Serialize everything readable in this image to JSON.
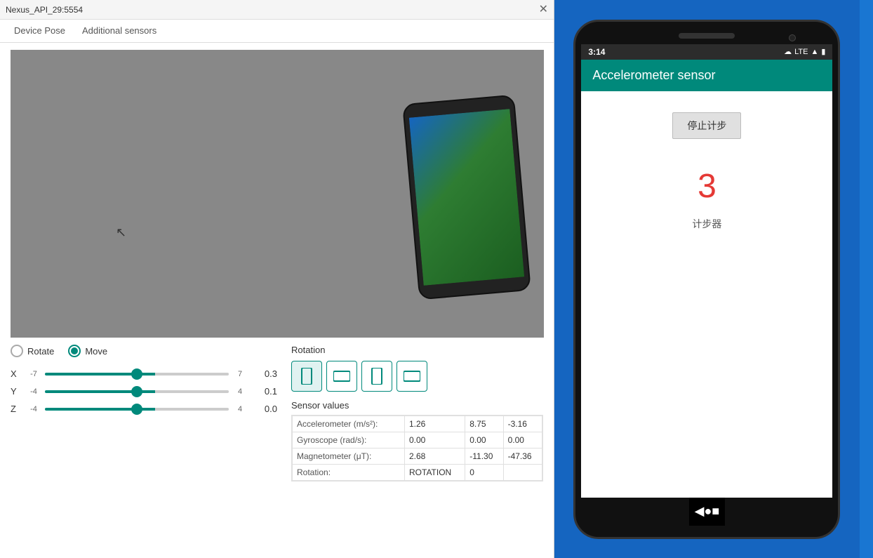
{
  "titleBar": {
    "text": "Nexus_API_29:5554",
    "closeBtn": "✕"
  },
  "tabs": [
    {
      "label": "Device Pose",
      "active": false
    },
    {
      "label": "Additional sensors",
      "active": false
    }
  ],
  "controls": {
    "rotateLabel": "Rotate",
    "moveLabel": "Move",
    "selectedMode": "Move",
    "axes": [
      {
        "label": "X",
        "min": "-7",
        "max": "7",
        "value": "0.3",
        "percent": 58
      },
      {
        "label": "Y",
        "min": "-4",
        "max": "4",
        "value": "0.1",
        "percent": 55
      },
      {
        "label": "Z",
        "min": "-4",
        "max": "4",
        "value": "0.0",
        "percent": 50
      }
    ]
  },
  "rotation": {
    "title": "Rotation",
    "buttons": [
      "portrait",
      "landscape-left",
      "portrait-reverse",
      "landscape-right"
    ]
  },
  "sensorValues": {
    "title": "Sensor values",
    "rows": [
      {
        "name": "Accelerometer (m/s²):",
        "v1": "1.26",
        "v2": "8.75",
        "v3": "-3.16"
      },
      {
        "name": "Gyroscope (rad/s):",
        "v1": "0.00",
        "v2": "0.00",
        "v3": "0.00"
      },
      {
        "name": "Magnetometer (μT):",
        "v1": "2.68",
        "v2": "-11.30",
        "v3": "-47.36"
      },
      {
        "name": "Rotation:",
        "v1": "ROTATION",
        "v2": "0",
        "v3": ""
      }
    ]
  },
  "phone": {
    "statusTime": "3:14",
    "statusLTE": "LTE",
    "appTitle": "Accelerometer sensor",
    "stopBtn": "停止计步",
    "stepCount": "3",
    "stepLabel": "计步器"
  }
}
